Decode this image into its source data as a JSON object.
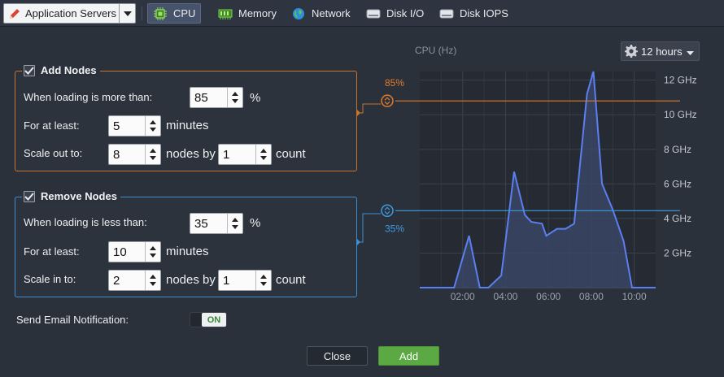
{
  "topbar": {
    "server_selector": "Application Servers",
    "tabs": [
      {
        "label": "CPU",
        "icon": "cpu-icon",
        "active": true
      },
      {
        "label": "Memory",
        "icon": "memory-icon",
        "active": false
      },
      {
        "label": "Network",
        "icon": "globe-icon",
        "active": false
      },
      {
        "label": "Disk I/O",
        "icon": "disk-icon",
        "active": false
      },
      {
        "label": "Disk IOPS",
        "icon": "disk-icon",
        "active": false
      }
    ]
  },
  "add_nodes": {
    "title": "Add Nodes",
    "checked": true,
    "loading_label": "When loading is more than:",
    "loading_value": "85",
    "loading_unit": "%",
    "duration_label": "For at least:",
    "duration_value": "5",
    "duration_unit": "minutes",
    "scale_label": "Scale out to:",
    "scale_value": "8",
    "nodes_by": "nodes by",
    "step_value": "1",
    "step_unit": "count"
  },
  "remove_nodes": {
    "title": "Remove Nodes",
    "checked": true,
    "loading_label": "When loading is less than:",
    "loading_value": "35",
    "loading_unit": "%",
    "duration_label": "For at least:",
    "duration_value": "10",
    "duration_unit": "minutes",
    "scale_label": "Scale in to:",
    "scale_value": "2",
    "nodes_by": "nodes by",
    "step_value": "1",
    "step_unit": "count"
  },
  "chart": {
    "title": "CPU (Hz)",
    "range_label": "12 hours",
    "upper_threshold_label": "85%",
    "lower_threshold_label": "35%"
  },
  "chart_data": {
    "type": "area",
    "title": "CPU (Hz)",
    "x_ticks": [
      "02:00",
      "04:00",
      "06:00",
      "08:00",
      "10:00"
    ],
    "y_ticks": [
      "2 GHz",
      "4 GHz",
      "6 GHz",
      "8 GHz",
      "10 GHz",
      "12 GHz"
    ],
    "xlim": [
      0,
      11
    ],
    "ylim": [
      0,
      12.5
    ],
    "series": [
      {
        "values": [
          {
            "x": 0.0,
            "y": 0
          },
          {
            "x": 1.6,
            "y": 0
          },
          {
            "x": 2.3,
            "y": 3.0
          },
          {
            "x": 2.8,
            "y": 0
          },
          {
            "x": 3.2,
            "y": 0
          },
          {
            "x": 3.8,
            "y": 0.7
          },
          {
            "x": 4.4,
            "y": 6.7
          },
          {
            "x": 4.9,
            "y": 4.2
          },
          {
            "x": 5.2,
            "y": 3.8
          },
          {
            "x": 5.7,
            "y": 3.7
          },
          {
            "x": 5.9,
            "y": 3.0
          },
          {
            "x": 6.4,
            "y": 3.4
          },
          {
            "x": 6.8,
            "y": 3.4
          },
          {
            "x": 7.2,
            "y": 3.7
          },
          {
            "x": 7.8,
            "y": 11.2
          },
          {
            "x": 8.1,
            "y": 12.5
          },
          {
            "x": 8.5,
            "y": 6.0
          },
          {
            "x": 9.0,
            "y": 4.5
          },
          {
            "x": 9.5,
            "y": 2.7
          },
          {
            "x": 9.9,
            "y": 0
          },
          {
            "x": 11.0,
            "y": 0
          }
        ]
      }
    ],
    "thresholds": [
      {
        "label": "85%",
        "y": 10.8,
        "color": "#e07a2a"
      },
      {
        "label": "35%",
        "y": 4.45,
        "color": "#3c9be0"
      }
    ],
    "grid": true,
    "colors": {
      "line": "#5b7ff0",
      "fill": "#3a4566"
    }
  },
  "email": {
    "label": "Send Email Notification:",
    "toggle": "ON"
  },
  "buttons": {
    "close": "Close",
    "add": "Add"
  }
}
